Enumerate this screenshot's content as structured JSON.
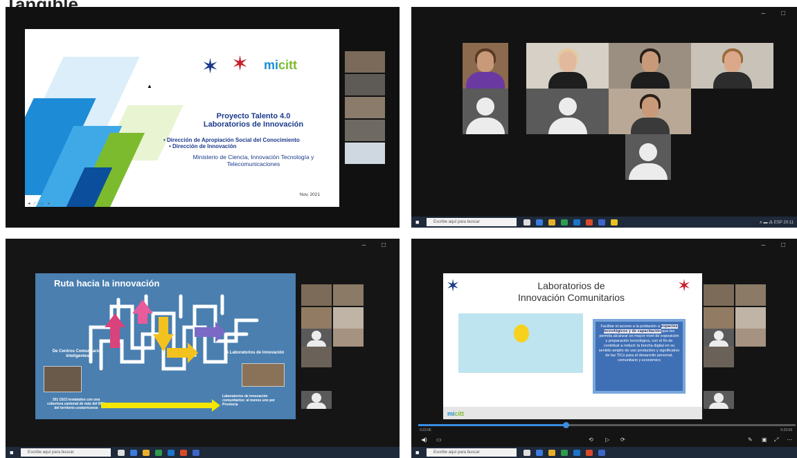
{
  "heading": "Tangible",
  "window_controls": "– □",
  "panel1": {
    "slide_title_line1": "Proyecto Talento 4.0",
    "slide_title_line2": "Laboratorios de Innovación",
    "bullet1": "•   Dirección de Apropiación Social del Conocimiento",
    "bullet2": "•   Dirección de Innovación",
    "ministry": "Ministerio de Ciencia, Innovación Tecnología y Telecomunicaciones",
    "date": "Nov, 2021",
    "logo_text": "mi",
    "logo_text_green": "citt",
    "toolbar": "◂ ∕ ▭ ▸"
  },
  "panel2": {
    "search_placeholder": "Escribe aquí para buscar",
    "tray": "∧ ▬ ⁂ ESP  20:11"
  },
  "panel3": {
    "slide_title": "Ruta hacia la innovación",
    "left_label": "De Centros Comunitarios Inteligentes",
    "right_label": "A Laboratorios de Innovación",
    "ceci_text": "201 CECI instalados con una cobertura cantonal de más del 60% del territorio costarricense",
    "labs_text": "Laboratorios de innovación comunitarios: al menos uno por Provincia",
    "search_placeholder": "Escribe aquí para buscar"
  },
  "panel4": {
    "slide_title_line1": "Laboratorios de",
    "slide_title_line2": "Innovación Comunitarios",
    "body_pre": "Facilitar el acceso a la población a ",
    "body_bold": "espacios tecnológicos y de capacitación",
    "body_post": " que les permita alcanzar un mayor nivel de exposición y preparación tecnológica, con el fin de contribuir a reducir la brecha digital en su sentido amplio de uso productivo y significativo de las TICs para el desarrollo personal, comunitario y económico",
    "logo_text": "mi",
    "logo_text_green": "citt",
    "time_elapsed": "0:22:05",
    "time_total": "0:23:58",
    "progress": 0.39,
    "search_placeholder": "Escribe aquí para buscar"
  }
}
